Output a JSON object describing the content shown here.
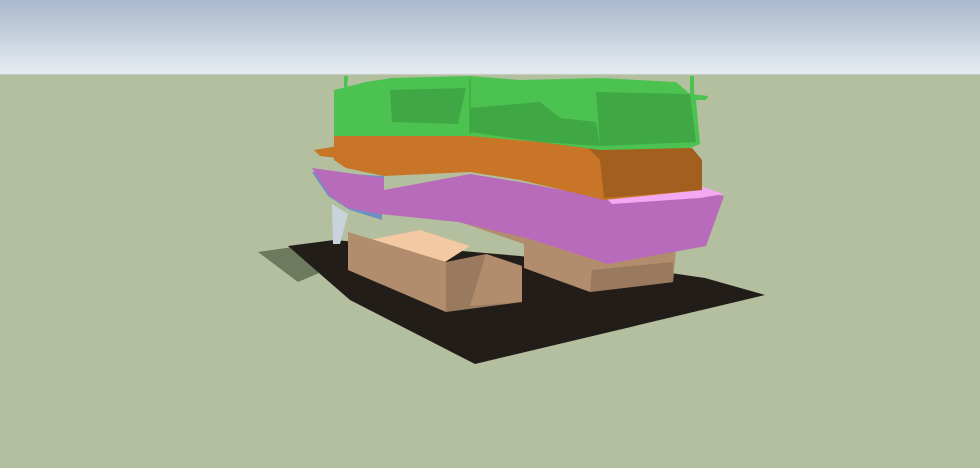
{
  "scene": {
    "kind": "3d-model-viewport",
    "colors": {
      "sky_top": "#a9b8cc",
      "sky_bottom": "#e6ecf1",
      "ground": "#b3bf9f",
      "shadow": "#231d1a",
      "shadow_soft": "#6e7a5e",
      "green_layer": "#4cc250",
      "green_shade": "#3fa845",
      "orange_layer": "#c87527",
      "orange_shade": "#a35f1e",
      "magenta_layer": "#b86bba",
      "magenta_light": "#f2a9f2",
      "blue_layer": "#6f8fc2",
      "tan_block": "#b28d6d",
      "tan_top": "#f2c9a2",
      "tan_side": "#9a7a5e"
    },
    "layers": [
      "green-layer",
      "orange-layer",
      "magenta-layer",
      "blue-wedge",
      "tan-blocks"
    ]
  }
}
